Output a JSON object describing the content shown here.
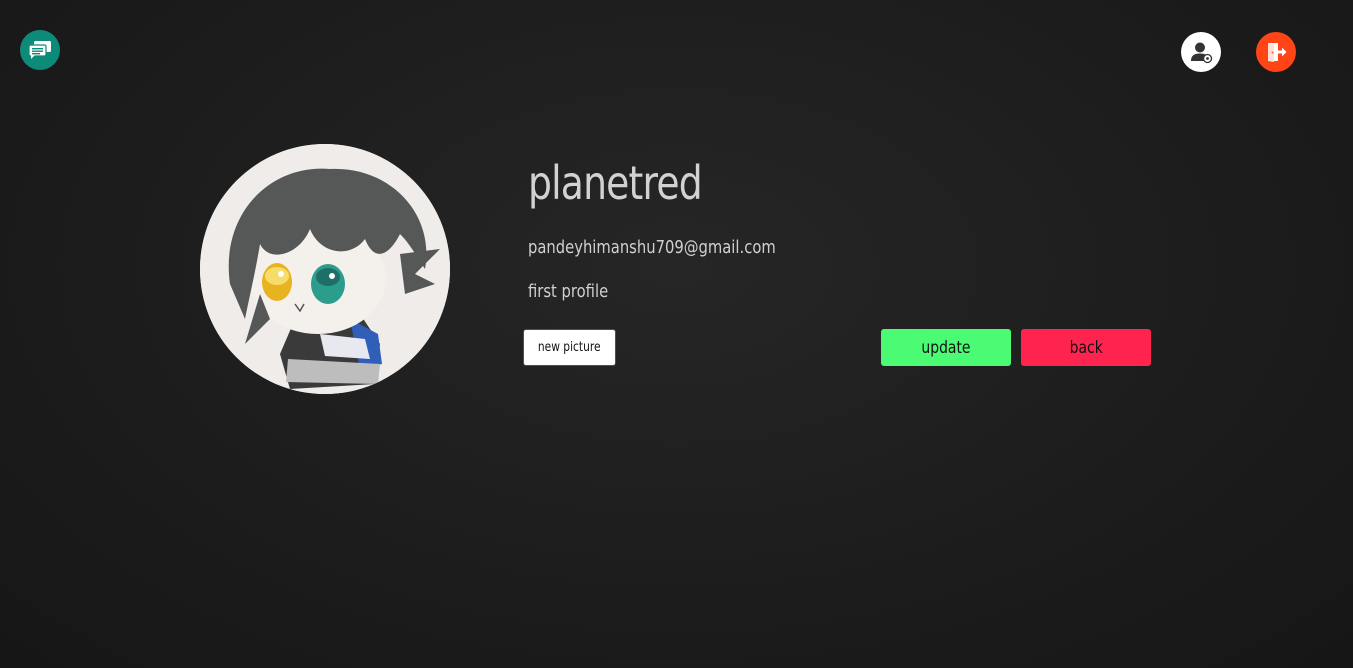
{
  "header": {
    "chat_icon": "chat-bubbles-icon",
    "profile_icon": "user-view-icon",
    "logout_icon": "logout-icon"
  },
  "profile": {
    "username": "planetred",
    "email": "pandeyhimanshu709@gmail.com",
    "bio": "first profile",
    "avatar": "anime-character-avatar"
  },
  "actions": {
    "new_picture_label": "new picture",
    "update_label": "update",
    "back_label": "back"
  },
  "colors": {
    "background": "#1e1e1e",
    "chat_button": "#0e8a78",
    "logout_button": "#ff4415",
    "update_button": "#4bfb74",
    "back_button": "#ff2450"
  }
}
